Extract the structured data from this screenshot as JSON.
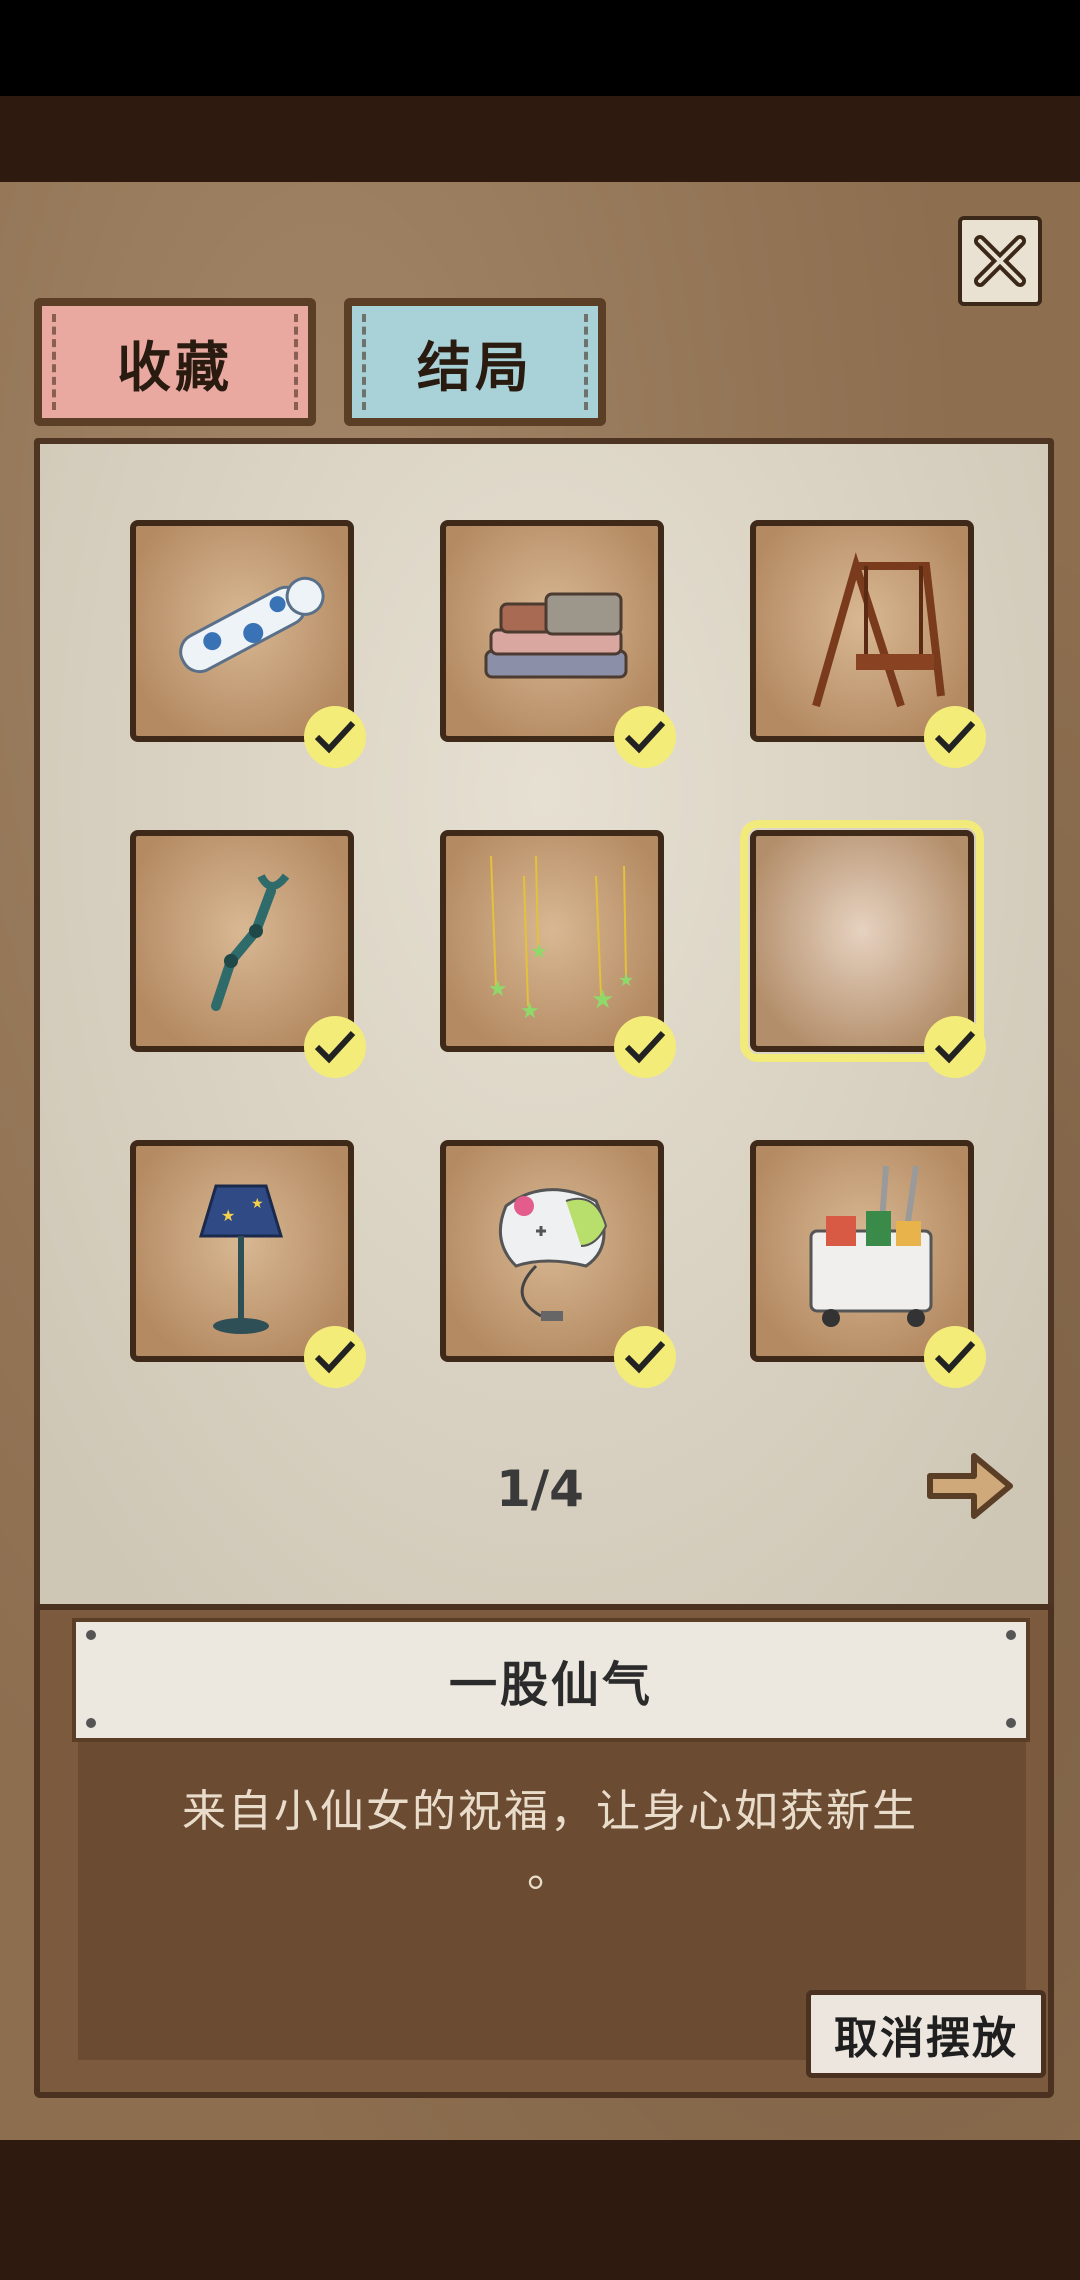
{
  "tabs": [
    {
      "label": "收藏",
      "color": "#e9a9a0"
    },
    {
      "label": "结局",
      "color": "#a9d2d8"
    }
  ],
  "grid": {
    "items": [
      {
        "icon": "cat-body-pillow-icon",
        "collected": true
      },
      {
        "icon": "stacked-clothes-icon",
        "collected": true
      },
      {
        "icon": "wooden-swing-icon",
        "collected": true
      },
      {
        "icon": "grabber-claw-icon",
        "collected": true
      },
      {
        "icon": "hanging-stars-icon",
        "collected": true
      },
      {
        "icon": "empty-slot-icon",
        "collected": true,
        "selected": true
      },
      {
        "icon": "star-lamp-icon",
        "collected": true
      },
      {
        "icon": "game-controller-icon",
        "collected": true
      },
      {
        "icon": "shopping-cart-icon",
        "collected": true
      }
    ]
  },
  "pagination": {
    "label": "1/4"
  },
  "info": {
    "title": "一股仙气",
    "description": "来自小仙女的祝福，让身心如获新生",
    "description_tail": "。"
  },
  "buttons": {
    "cancel_label": "取消摆放"
  },
  "colors": {
    "check": "#f3ec78",
    "selected_outline": "#f2ea7a"
  }
}
